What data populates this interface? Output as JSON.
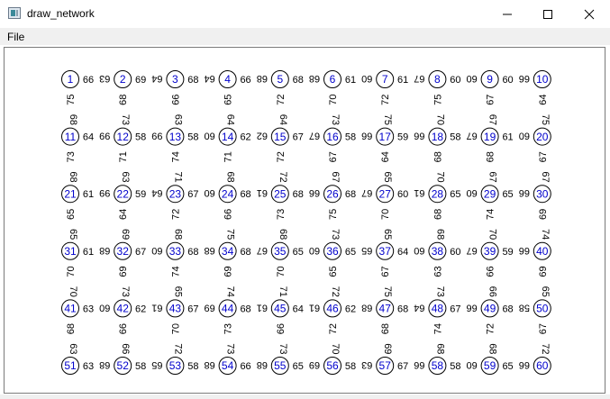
{
  "window": {
    "title": "draw_network"
  },
  "menu": {
    "items": [
      "File"
    ]
  },
  "network": {
    "rows": 6,
    "cols": 10,
    "node_labels": [
      "1",
      "2",
      "3",
      "4",
      "5",
      "6",
      "7",
      "8",
      "9",
      "10",
      "11",
      "12",
      "13",
      "14",
      "15",
      "16",
      "17",
      "18",
      "19",
      "20",
      "21",
      "22",
      "23",
      "24",
      "25",
      "26",
      "27",
      "28",
      "29",
      "30",
      "31",
      "32",
      "33",
      "34",
      "35",
      "36",
      "37",
      "38",
      "39",
      "40",
      "41",
      "42",
      "43",
      "44",
      "45",
      "46",
      "47",
      "48",
      "49",
      "50",
      "51",
      "52",
      "53",
      "54",
      "55",
      "56",
      "57",
      "58",
      "59",
      "60"
    ],
    "horizontal_edges": [
      [
        "66 · 63",
        "69 · 64",
        "68 · 64",
        "66 · 68",
        "68 · 68",
        "61 · 60",
        "61 · 67",
        "60 · 60",
        "60 · 66"
      ],
      [
        "64 · 99",
        "58 · 99",
        "58 · 60",
        "62 · 62",
        "67 · 67",
        "58 · 66",
        "59 · 66",
        "58 · 67",
        "61 · 60"
      ],
      [
        "61 · 99",
        "59 · 64",
        "67 · 60",
        "68 · 61",
        "68 · 66",
        "68 · 67",
        "60 · 61",
        "65 · 60",
        "65 · 66"
      ],
      [
        "61 · 68",
        "67 · 60",
        "68 · 68",
        "68 · 67",
        "65 · 60",
        "65 · 65",
        "64 · 60",
        "60 · 67",
        "59 · 66"
      ],
      [
        "63 · 60",
        "62 · 61",
        "67 · 69",
        "68 · 61",
        "64 · 61",
        "62 · 68",
        "68 · 64",
        "67 · 66",
        "68 · 58"
      ],
      [
        "63 · 68",
        "58 · 65",
        "58 · 68",
        "66 · 68",
        "65 · 69",
        "58 · 63",
        "67 · 66",
        "58 · 60",
        "65 · 66"
      ]
    ],
    "vertical_edges": [
      [
        "75 · 68",
        "68 · 73",
        "66 · 63",
        "65 · 64",
        "72 · 64",
        "70 · 73",
        "72 · 75",
        "75 · 70",
        "67 · 67",
        "64 · 75"
      ],
      [
        "73 · 68",
        "71 · 63",
        "74 · 71",
        "71 · 68",
        "72 · 72",
        "67 · 67",
        "64 · 65",
        "68 · 70",
        "68 · 67",
        "67 · 67"
      ],
      [
        "65 · 65",
        "64 · 69",
        "72 · 68",
        "66 · 75",
        "73 · 68",
        "75 · 73",
        "70 · 65",
        "68 · 68",
        "74 · 70",
        "69 · 74"
      ],
      [
        "70 · 70",
        "69 · 73",
        "74 · 65",
        "69 · 74",
        "70 · 71",
        "65 · 72",
        "67 · 75",
        "63 · 73",
        "66 · 66",
        "69 · 65"
      ],
      [
        "68 · 63",
        "66 · 66",
        "70 · 72",
        "73 · 73",
        "66 · 73",
        "72 · 70",
        "68 · 69",
        "74 · 68",
        "72 · 68",
        "67 · 72"
      ]
    ]
  }
}
